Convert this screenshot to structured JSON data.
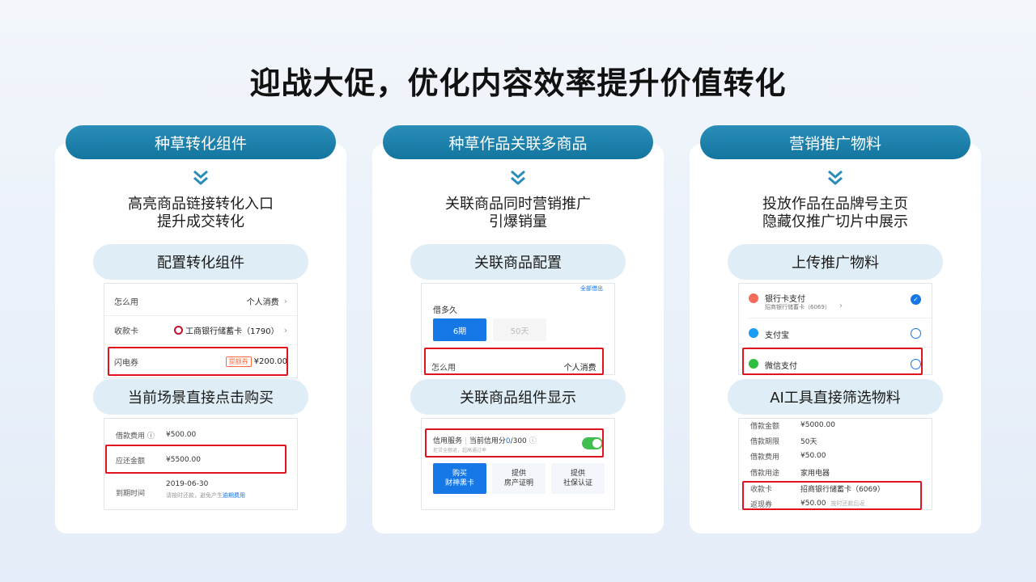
{
  "title": "迎战大促，优化内容效率提升价值转化",
  "colors": {
    "accent": "#1a7ea8",
    "pill_bg": "#dfeef6",
    "red_box": "#e0141e",
    "blue_btn": "#1677e6"
  },
  "columns": [
    {
      "header": "种草转化组件",
      "desc_line1": "高亮商品链接转化入口",
      "desc_line2": "提升成交转化",
      "sub1": "配置转化组件",
      "sub2": "当前场景直接点击购买",
      "shot1": {
        "rows": [
          {
            "label": "怎么用",
            "value": "个人消费"
          },
          {
            "label": "收款卡",
            "value": "工商银行储蓄卡（1790）"
          },
          {
            "label": "闪电券",
            "tag": "提额券",
            "value": "¥200.00"
          }
        ]
      },
      "shot2": {
        "rows": [
          {
            "label": "借款费用 ⓘ",
            "value": "¥500.00"
          },
          {
            "label": "应还金额",
            "value": "¥5500.00"
          },
          {
            "label": "到期时间",
            "value": "2019-06-30",
            "note": "请按时还款，避免产生",
            "note_link": "逾期费用"
          }
        ]
      }
    },
    {
      "header": "种草作品关联多商品",
      "desc_line1": "关联商品同时营销推广",
      "desc_line2": "引爆销量",
      "sub1": "关联商品配置",
      "sub2": "关联商品组件显示",
      "shot1": {
        "corner_link": "全部借出",
        "question": "借多久",
        "opt_selected": "6期",
        "opt_other": "50天",
        "row_label": "怎么用",
        "row_value": "个人消费"
      },
      "shot2": {
        "line_a": "信用服务",
        "line_b": "当前信用分",
        "score": "0",
        "score_total": "/300",
        "hint": "拒贷全额退，超高通过率",
        "btn1_l1": "购买",
        "btn1_l2": "财神黑卡",
        "btn2_l1": "提供",
        "btn2_l2": "房产证明",
        "btn3_l1": "提供",
        "btn3_l2": "社保认证"
      }
    },
    {
      "header": "营销推广物料",
      "desc_line1": "投放作品在品牌号主页",
      "desc_line2": "隐藏仅推广切片中展示",
      "sub1": "上传推广物料",
      "sub2": "AI工具直接筛选物料",
      "shot1": {
        "opt1": "银行卡支付",
        "opt1_sub": "招商银行储蓄卡（6069）",
        "opt2": "支付宝",
        "opt3": "微信支付"
      },
      "shot2": {
        "rows": [
          {
            "label": "借款金额",
            "value": "¥5000.00"
          },
          {
            "label": "借款期限",
            "value": "50天"
          },
          {
            "label": "借款费用",
            "value": "¥50.00"
          },
          {
            "label": "借款用途",
            "value": "家用电器"
          },
          {
            "label": "收款卡",
            "value": "招商银行储蓄卡（6069）"
          },
          {
            "label": "返现券",
            "value": "¥50.00",
            "note": "按时还款后返"
          }
        ]
      }
    }
  ]
}
